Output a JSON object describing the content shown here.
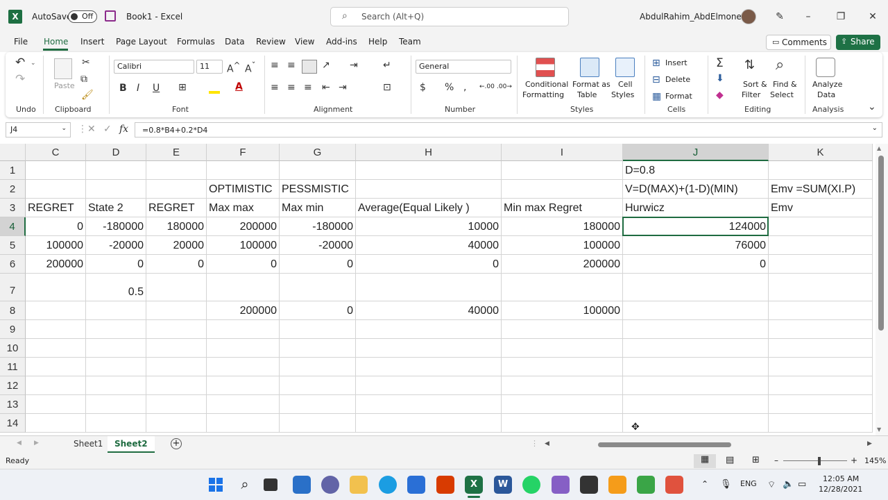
{
  "titlebar": {
    "app_icon": "X",
    "autosave_label": "AutoSave",
    "autosave_state": "Off",
    "doc_title": "Book1  -  Excel",
    "search_placeholder": "Search (Alt+Q)",
    "user_name": "AbdulRahim_AbdElmonem"
  },
  "menu": {
    "items": [
      "File",
      "Home",
      "Insert",
      "Page Layout",
      "Formulas",
      "Data",
      "Review",
      "View",
      "Add-ins",
      "Help",
      "Team"
    ],
    "active": "Home",
    "comments_label": "Comments",
    "share_label": "Share"
  },
  "ribbon": {
    "groups": [
      "Undo",
      "Clipboard",
      "Font",
      "Alignment",
      "Number",
      "Styles",
      "Cells",
      "Editing",
      "Analysis"
    ],
    "paste_label": "Paste",
    "font_name": "Calibri",
    "font_size": "11",
    "bold": "B",
    "italic": "I",
    "underline": "U",
    "number_format": "General",
    "conditional_formatting": [
      "Conditional",
      "Formatting"
    ],
    "format_as_table": [
      "Format as",
      "Table"
    ],
    "cell_styles": [
      "Cell",
      "Styles"
    ],
    "insert_label": "Insert",
    "delete_label": "Delete",
    "format_label": "Format",
    "sort_filter": [
      "Sort &",
      "Filter"
    ],
    "find_select": [
      "Find &",
      "Select"
    ],
    "analyze_data": [
      "Analyze",
      "Data"
    ]
  },
  "formula_bar": {
    "name_box": "J4",
    "fx": "fx",
    "formula": "=0.8*B4+0.2*D4"
  },
  "sheet": {
    "columns": [
      "C",
      "D",
      "E",
      "F",
      "G",
      "H",
      "I",
      "J",
      "K"
    ],
    "selected_column": "J",
    "rows": [
      "1",
      "2",
      "3",
      "4",
      "5",
      "6",
      "7",
      "8",
      "9",
      "10",
      "11",
      "12",
      "13",
      "14"
    ],
    "selected_row": "4",
    "active_cell": "J4",
    "cells": {
      "J1": "D=0.8",
      "F2": "OPTIMISTIC",
      "G2": "PESSMISTIC",
      "J2": "V=D(MAX)+(1-D)(MIN)",
      "K2": "Emv =SUM(XI.P)",
      "C3": "REGRET",
      "D3": "State 2",
      "E3": "REGRET",
      "F3": "Max max",
      "G3": "Max min",
      "H3": "Average(Equal Likely )",
      "I3": "Min max Regret",
      "J3": "Hurwicz",
      "K3": "Emv",
      "C4": "0",
      "D4": "-180000",
      "E4": "180000",
      "F4": "200000",
      "G4": "-180000",
      "H4": "10000",
      "I4": "180000",
      "J4": "124000",
      "C5": "100000",
      "D5": "-20000",
      "E5": "20000",
      "F5": "100000",
      "G5": "-20000",
      "H5": "40000",
      "I5": "100000",
      "J5": "76000",
      "C6": "200000",
      "D6": "0",
      "E6": "0",
      "F6": "0",
      "G6": "0",
      "H6": "0",
      "I6": "200000",
      "J6": "0",
      "D7": "0.5",
      "F8": "200000",
      "G8": "0",
      "H8": "40000",
      "I8": "100000"
    }
  },
  "tabs": {
    "items": [
      "Sheet1",
      "Sheet2"
    ],
    "active": "Sheet2"
  },
  "status": {
    "ready": "Ready",
    "zoom": "145%"
  },
  "taskbar": {
    "lang": "ENG",
    "time": "12:05 AM",
    "date": "12/28/2021"
  },
  "colors": {
    "excel_green": "#1e6b40",
    "share_green": "#1e7145"
  }
}
